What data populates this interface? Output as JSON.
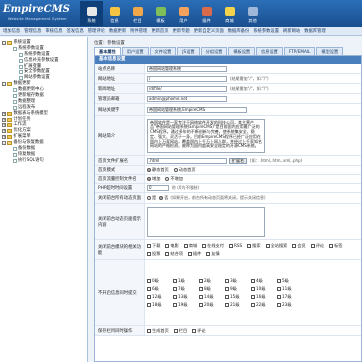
{
  "header": {
    "logo": "EmpireCMS",
    "logo_sub": "Website Management System",
    "nav": [
      {
        "label": "系统",
        "icon": "system-icon",
        "color": "#e8e8e8"
      },
      {
        "label": "信息",
        "icon": "info-icon",
        "color": "#f5c542"
      },
      {
        "label": "栏目",
        "icon": "column-icon",
        "color": "#f0a74a"
      },
      {
        "label": "模板",
        "icon": "template-icon",
        "color": "#7fbf5a"
      },
      {
        "label": "用户",
        "icon": "user-icon",
        "color": "#f2a25c"
      },
      {
        "label": "插件",
        "icon": "plugin-icon",
        "color": "#d96b4a"
      },
      {
        "label": "商城",
        "icon": "shop-icon",
        "color": "#f3d24c"
      },
      {
        "label": "其他",
        "icon": "other-icon",
        "color": "#9fb7d9"
      }
    ]
  },
  "menubar": [
    "增加信息",
    "管理信息",
    "审核信息",
    "签发信息",
    "管理评论",
    "数据更新",
    "附件管理",
    "更新首页",
    "更新专题",
    "更新自定义页面",
    "数据库备份",
    "系统参数设置",
    "刷新网站",
    "数据库管理"
  ],
  "sidebar": [
    {
      "label": "系统设置",
      "level": 0,
      "tw": "-",
      "open": true
    },
    {
      "label": "系统参数设置",
      "level": 1,
      "tw": "",
      "open": false
    },
    {
      "label": "系统参数设置",
      "level": 2,
      "tw": "",
      "open": false
    },
    {
      "label": "信息补充参数设置",
      "level": 2,
      "tw": "",
      "open": false
    },
    {
      "label": "扩展变量",
      "level": 2,
      "tw": "",
      "open": false
    },
    {
      "label": "安全参数配置",
      "level": 2,
      "tw": "",
      "open": false
    },
    {
      "label": "网站参数设置",
      "level": 2,
      "tw": "",
      "open": false
    },
    {
      "label": "数据更新",
      "level": 0,
      "tw": "-",
      "open": true
    },
    {
      "label": "数据更新中心",
      "level": 1,
      "tw": "",
      "open": false
    },
    {
      "label": "更新缓存数据",
      "level": 1,
      "tw": "",
      "open": false
    },
    {
      "label": "数据整理",
      "level": 1,
      "tw": "",
      "open": false
    },
    {
      "label": "远程发布",
      "level": 1,
      "tw": "",
      "open": false
    },
    {
      "label": "数据表与系统模型",
      "level": 0,
      "tw": "+",
      "open": false
    },
    {
      "label": "计划任务",
      "level": 0,
      "tw": "+",
      "open": false
    },
    {
      "label": "工作流",
      "level": 0,
      "tw": "+",
      "open": false
    },
    {
      "label": "优化方案",
      "level": 0,
      "tw": "+",
      "open": false
    },
    {
      "label": "扩展菜单",
      "level": 0,
      "tw": "+",
      "open": false
    },
    {
      "label": "备份与恢复数据",
      "level": 0,
      "tw": "-",
      "open": true
    },
    {
      "label": "备份数据",
      "level": 1,
      "tw": "",
      "open": false
    },
    {
      "label": "恢复数据",
      "level": 1,
      "tw": "",
      "open": false
    },
    {
      "label": "执行SQL语句",
      "level": 1,
      "tw": "",
      "open": false
    }
  ],
  "main": {
    "breadcrumb": "位置：参数设置",
    "tabs": [
      "基本属性",
      "用户设置",
      "文件设置",
      "JS设置",
      "分组设置",
      "模板设置",
      "信息设置",
      "FTP/EMAIL",
      "模型设置"
    ],
    "panel_title": "基本信息设置",
    "fields": {
      "site_name_label": "站点名称",
      "site_name_value": "帝国网站管理系统",
      "site_url_label": "网站地址",
      "site_url_value": "/",
      "site_url_hint": "(结尾需加\"/\"，如:\"/\")",
      "news_url_label": "新闻地址",
      "news_url_value": "/d/file/",
      "news_url_hint": "(结尾需加\"/\"，如:\"/\")",
      "admin_email_label": "管理员邮箱",
      "admin_email_value": "admin@phome.net",
      "site_keywords_label": "网站关键字",
      "site_keywords_value": "帝国网站管理系统,EmpireCMS",
      "site_intro_label": "网站简介",
      "site_intro_value": "帝国软件是一家专注于网络软件开发的科技公司，其主营产品\"帝国网站管理系统(EmpireCMS)\"是目前国内应用最广泛的CMS程序。通过多年的不断创新与完善，使系统集安全、稳定、强大、灵活于一身。目前EmpireCMS程序已经广泛应用在国内上万家网站，覆盖国内上千万上网人群，并经过上千家知名网站的严格检测，被称为国内超高安全稳定的开源CMS系统。",
      "index_ext_label": "首页文件扩展名",
      "index_ext_value": ".html",
      "index_ext_btn": "扩展名",
      "index_ext_hint": "(如：.html,.htm,.xml,.php)",
      "index_mode_label": "首页模式",
      "index_mode_options": [
        "静态首页",
        "动态首页"
      ],
      "index_mode_selected": 0,
      "php_index_label": "首页流量控制文件名",
      "php_index_options": [
        "增加",
        "不增加"
      ],
      "php_max_label": "PHP超时时间设置",
      "php_max_value": "0",
      "php_max_hint": "秒 (0为不限制)",
      "close_site_label": "关闭前台所有动态页面",
      "close_site_options": [
        "是",
        "否"
      ],
      "close_site_hint": "(如果开启，前台所有动态页面将关闭，提示关闭信息)",
      "close_tip_label": "关闭前台动态页面提示内容",
      "close_tip_value": "",
      "close_module_label": "关闭前台模块的相关功能",
      "close_modules": [
        "下载",
        "电影",
        "商城",
        "在线支付",
        "RSS",
        "搜索",
        "全站搜索",
        "会员",
        "评论",
        "标签",
        "投票",
        "结合项",
        "插件",
        "友情"
      ],
      "static_levels_label": "不开启信息同时提交",
      "static_levels": [
        "0级",
        "1级",
        "2级",
        "3级",
        "4级",
        "5级",
        "6级",
        "7级",
        "8级",
        "9级",
        "10级",
        "11级",
        "12级",
        "13级",
        "14级",
        "15级",
        "16级",
        "17级",
        "18级",
        "19级",
        "20级",
        "21级",
        "22级",
        "23级"
      ],
      "footer_label": "保存栏目同时操作",
      "footer_options": [
        "生成首页",
        "栏目",
        "评论"
      ]
    }
  }
}
